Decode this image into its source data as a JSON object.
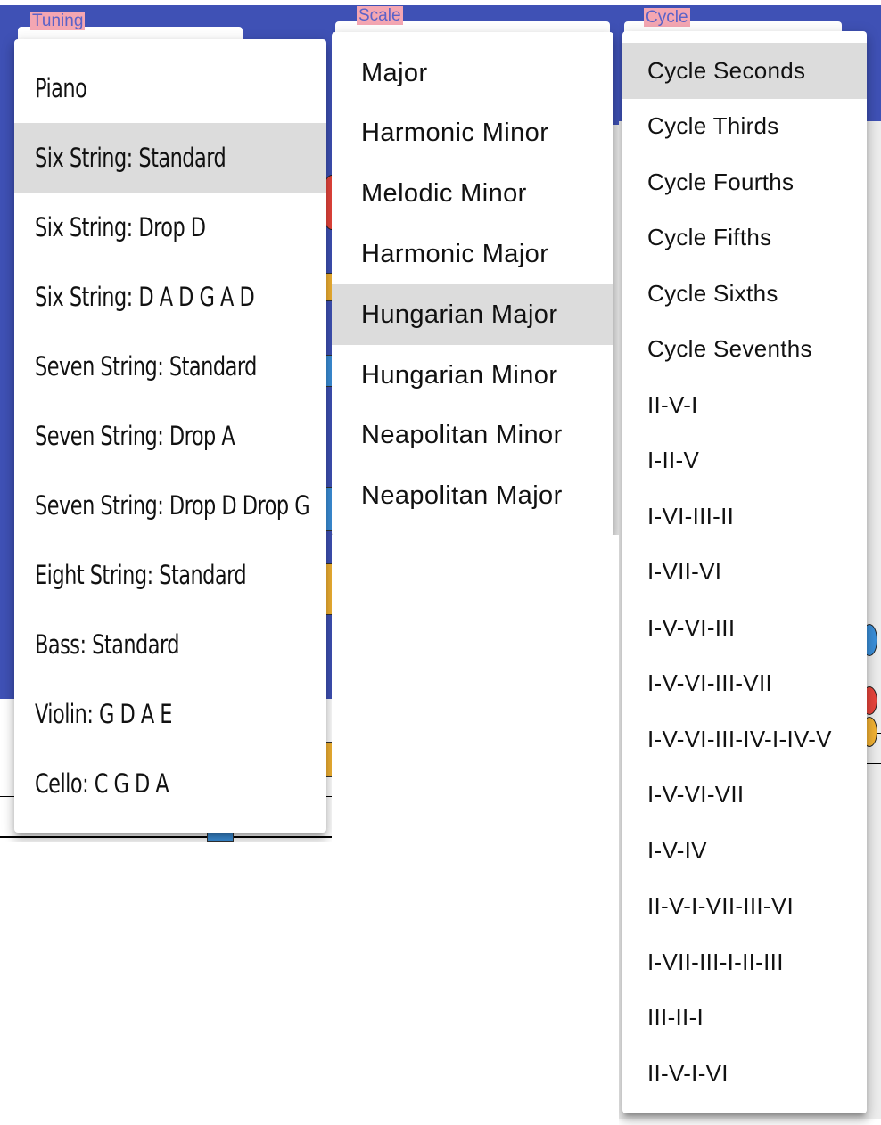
{
  "tuning": {
    "label": "Tuning",
    "options": [
      "Piano",
      "Six String: Standard",
      "Six String: Drop D",
      "Six String: D A D G A D",
      "Seven String: Standard",
      "Seven String: Drop A",
      "Seven String: Drop D Drop G",
      "Eight String: Standard",
      "Bass: Standard",
      "Violin: G D A E",
      "Cello: C G D A"
    ],
    "selected": "Six String: Standard"
  },
  "scale": {
    "label": "Scale",
    "options": [
      "Major",
      "Harmonic Minor",
      "Melodic Minor",
      "Harmonic Major",
      "Hungarian Major",
      "Hungarian Minor",
      "Neapolitan Minor",
      "Neapolitan Major"
    ],
    "selected": "Hungarian Major"
  },
  "cycle": {
    "label": "Cycle",
    "options": [
      "Cycle Seconds",
      "Cycle Thirds",
      "Cycle Fourths",
      "Cycle Fifths",
      "Cycle Sixths",
      "Cycle Sevenths",
      "II-V-I",
      "I-II-V",
      "I-VI-III-II",
      "I-VII-VI",
      "I-V-VI-III",
      "I-V-VI-III-VII",
      "I-V-VI-III-IV-I-IV-V",
      "I-V-VI-VII",
      "I-V-IV",
      "II-V-I-VII-III-VI",
      "I-VII-III-I-II-III",
      "III-II-I",
      "II-V-I-VI"
    ],
    "selected": "Cycle Seconds"
  },
  "colors": {
    "appbar": "#3f51b5",
    "legend_bg": "#f4a6b2",
    "legend_text": "#5b62c8",
    "selected_bg": "#dcdcdc",
    "note_red": "#e8453c",
    "note_blue": "#3b8fd9",
    "note_yellow": "#f2b233"
  }
}
